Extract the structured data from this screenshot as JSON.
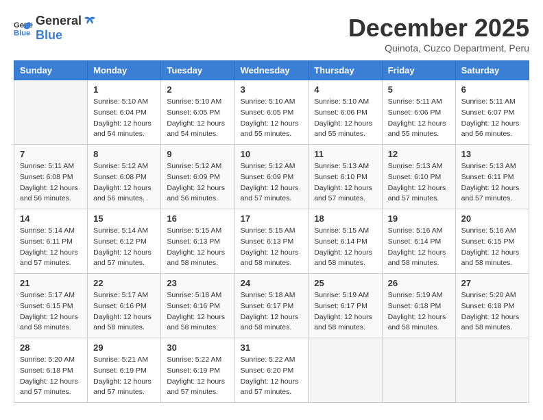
{
  "logo": {
    "general": "General",
    "blue": "Blue"
  },
  "title": "December 2025",
  "subtitle": "Quinota, Cuzco Department, Peru",
  "headers": [
    "Sunday",
    "Monday",
    "Tuesday",
    "Wednesday",
    "Thursday",
    "Friday",
    "Saturday"
  ],
  "weeks": [
    [
      {
        "day": "",
        "info": ""
      },
      {
        "day": "1",
        "info": "Sunrise: 5:10 AM\nSunset: 6:04 PM\nDaylight: 12 hours\nand 54 minutes."
      },
      {
        "day": "2",
        "info": "Sunrise: 5:10 AM\nSunset: 6:05 PM\nDaylight: 12 hours\nand 54 minutes."
      },
      {
        "day": "3",
        "info": "Sunrise: 5:10 AM\nSunset: 6:05 PM\nDaylight: 12 hours\nand 55 minutes."
      },
      {
        "day": "4",
        "info": "Sunrise: 5:10 AM\nSunset: 6:06 PM\nDaylight: 12 hours\nand 55 minutes."
      },
      {
        "day": "5",
        "info": "Sunrise: 5:11 AM\nSunset: 6:06 PM\nDaylight: 12 hours\nand 55 minutes."
      },
      {
        "day": "6",
        "info": "Sunrise: 5:11 AM\nSunset: 6:07 PM\nDaylight: 12 hours\nand 56 minutes."
      }
    ],
    [
      {
        "day": "7",
        "info": "Sunrise: 5:11 AM\nSunset: 6:08 PM\nDaylight: 12 hours\nand 56 minutes."
      },
      {
        "day": "8",
        "info": "Sunrise: 5:12 AM\nSunset: 6:08 PM\nDaylight: 12 hours\nand 56 minutes."
      },
      {
        "day": "9",
        "info": "Sunrise: 5:12 AM\nSunset: 6:09 PM\nDaylight: 12 hours\nand 56 minutes."
      },
      {
        "day": "10",
        "info": "Sunrise: 5:12 AM\nSunset: 6:09 PM\nDaylight: 12 hours\nand 57 minutes."
      },
      {
        "day": "11",
        "info": "Sunrise: 5:13 AM\nSunset: 6:10 PM\nDaylight: 12 hours\nand 57 minutes."
      },
      {
        "day": "12",
        "info": "Sunrise: 5:13 AM\nSunset: 6:10 PM\nDaylight: 12 hours\nand 57 minutes."
      },
      {
        "day": "13",
        "info": "Sunrise: 5:13 AM\nSunset: 6:11 PM\nDaylight: 12 hours\nand 57 minutes."
      }
    ],
    [
      {
        "day": "14",
        "info": "Sunrise: 5:14 AM\nSunset: 6:11 PM\nDaylight: 12 hours\nand 57 minutes."
      },
      {
        "day": "15",
        "info": "Sunrise: 5:14 AM\nSunset: 6:12 PM\nDaylight: 12 hours\nand 57 minutes."
      },
      {
        "day": "16",
        "info": "Sunrise: 5:15 AM\nSunset: 6:13 PM\nDaylight: 12 hours\nand 58 minutes."
      },
      {
        "day": "17",
        "info": "Sunrise: 5:15 AM\nSunset: 6:13 PM\nDaylight: 12 hours\nand 58 minutes."
      },
      {
        "day": "18",
        "info": "Sunrise: 5:15 AM\nSunset: 6:14 PM\nDaylight: 12 hours\nand 58 minutes."
      },
      {
        "day": "19",
        "info": "Sunrise: 5:16 AM\nSunset: 6:14 PM\nDaylight: 12 hours\nand 58 minutes."
      },
      {
        "day": "20",
        "info": "Sunrise: 5:16 AM\nSunset: 6:15 PM\nDaylight: 12 hours\nand 58 minutes."
      }
    ],
    [
      {
        "day": "21",
        "info": "Sunrise: 5:17 AM\nSunset: 6:15 PM\nDaylight: 12 hours\nand 58 minutes."
      },
      {
        "day": "22",
        "info": "Sunrise: 5:17 AM\nSunset: 6:16 PM\nDaylight: 12 hours\nand 58 minutes."
      },
      {
        "day": "23",
        "info": "Sunrise: 5:18 AM\nSunset: 6:16 PM\nDaylight: 12 hours\nand 58 minutes."
      },
      {
        "day": "24",
        "info": "Sunrise: 5:18 AM\nSunset: 6:17 PM\nDaylight: 12 hours\nand 58 minutes."
      },
      {
        "day": "25",
        "info": "Sunrise: 5:19 AM\nSunset: 6:17 PM\nDaylight: 12 hours\nand 58 minutes."
      },
      {
        "day": "26",
        "info": "Sunrise: 5:19 AM\nSunset: 6:18 PM\nDaylight: 12 hours\nand 58 minutes."
      },
      {
        "day": "27",
        "info": "Sunrise: 5:20 AM\nSunset: 6:18 PM\nDaylight: 12 hours\nand 58 minutes."
      }
    ],
    [
      {
        "day": "28",
        "info": "Sunrise: 5:20 AM\nSunset: 6:18 PM\nDaylight: 12 hours\nand 57 minutes."
      },
      {
        "day": "29",
        "info": "Sunrise: 5:21 AM\nSunset: 6:19 PM\nDaylight: 12 hours\nand 57 minutes."
      },
      {
        "day": "30",
        "info": "Sunrise: 5:22 AM\nSunset: 6:19 PM\nDaylight: 12 hours\nand 57 minutes."
      },
      {
        "day": "31",
        "info": "Sunrise: 5:22 AM\nSunset: 6:20 PM\nDaylight: 12 hours\nand 57 minutes."
      },
      {
        "day": "",
        "info": ""
      },
      {
        "day": "",
        "info": ""
      },
      {
        "day": "",
        "info": ""
      }
    ]
  ]
}
